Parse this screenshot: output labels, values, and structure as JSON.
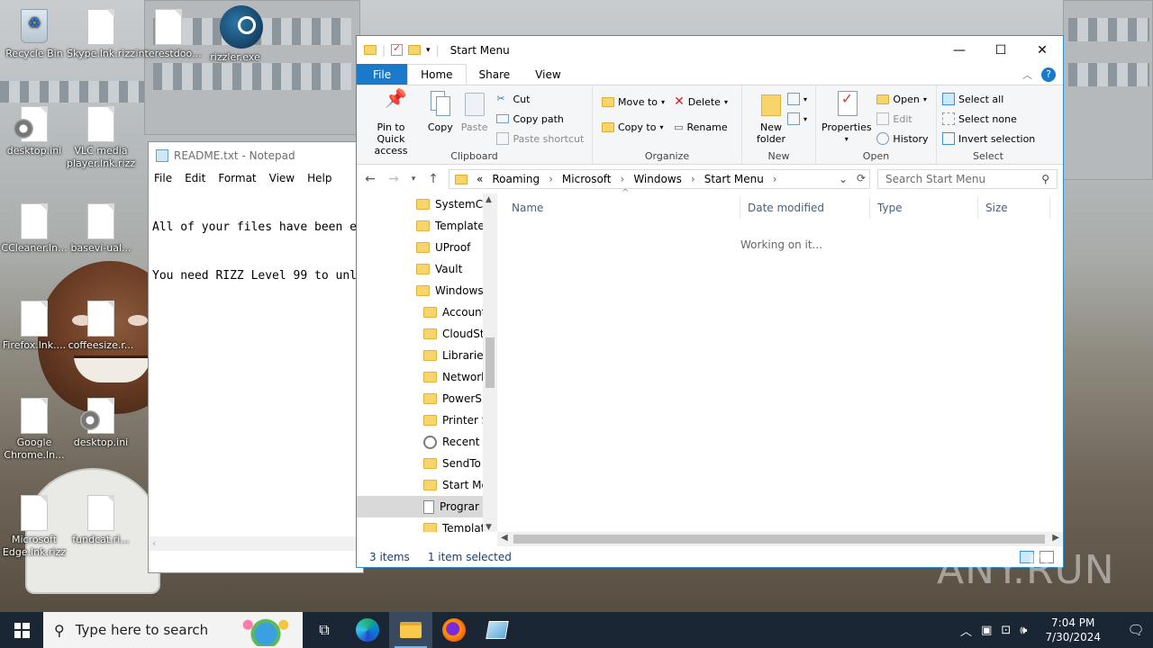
{
  "desktop": {
    "icons": [
      {
        "label": "Recycle Bin"
      },
      {
        "label": "Skype.lnk.rizz"
      },
      {
        "label": "interestdoo..."
      },
      {
        "label": "rizzler.exe"
      },
      {
        "label": "desktop.ini"
      },
      {
        "label": "VLC media player.lnk.rizz"
      },
      {
        "label": "CCleaner.ln..."
      },
      {
        "label": "basevi-ual..."
      },
      {
        "label": "Firefox.lnk...."
      },
      {
        "label": "coffeesize.r..."
      },
      {
        "label": "Google Chrome.ln..."
      },
      {
        "label": "desktop.ini"
      },
      {
        "label": "Microsoft Edge.lnk.rizz"
      },
      {
        "label": "fundcat.ri..."
      }
    ]
  },
  "notepad": {
    "title": "README.txt - Notepad",
    "menu": [
      "File",
      "Edit",
      "Format",
      "View",
      "Help"
    ],
    "lines": [
      "All of your files have been e",
      "You need RIZZ Level 99 to unl"
    ]
  },
  "explorer": {
    "title": "Start Menu",
    "tabs": {
      "file": "File",
      "home": "Home",
      "share": "Share",
      "view": "View"
    },
    "ribbon": {
      "clipboard": {
        "label": "Clipboard",
        "pin": "Pin to Quick access",
        "copy": "Copy",
        "paste": "Paste",
        "cut": "Cut",
        "copy_path": "Copy path",
        "paste_shortcut": "Paste shortcut"
      },
      "organize": {
        "label": "Organize",
        "move_to": "Move to",
        "copy_to": "Copy to",
        "delete": "Delete",
        "rename": "Rename"
      },
      "new": {
        "label": "New",
        "new_folder": "New folder"
      },
      "open": {
        "label": "Open",
        "properties": "Properties",
        "open": "Open",
        "edit": "Edit",
        "history": "History"
      },
      "select": {
        "label": "Select",
        "select_all": "Select all",
        "select_none": "Select none",
        "invert": "Invert selection"
      }
    },
    "address": {
      "overflow": "«",
      "crumbs": [
        "Roaming",
        "Microsoft",
        "Windows",
        "Start Menu"
      ]
    },
    "search_placeholder": "Search Start Menu",
    "nav_items": [
      {
        "label": "SystemCer",
        "icon": "folder",
        "sub": false
      },
      {
        "label": "Templates",
        "icon": "folder",
        "sub": false
      },
      {
        "label": "UProof",
        "icon": "folder",
        "sub": false
      },
      {
        "label": "Vault",
        "icon": "folder",
        "sub": false
      },
      {
        "label": "Windows",
        "icon": "folder",
        "sub": false
      },
      {
        "label": "Account",
        "icon": "folder",
        "sub": true
      },
      {
        "label": "CloudSto",
        "icon": "folder",
        "sub": true
      },
      {
        "label": "Libraries",
        "icon": "folder",
        "sub": true
      },
      {
        "label": "Network",
        "icon": "folder",
        "sub": true
      },
      {
        "label": "PowerSh",
        "icon": "folder",
        "sub": true
      },
      {
        "label": "Printer Sl",
        "icon": "folder",
        "sub": true
      },
      {
        "label": "Recent It",
        "icon": "recent",
        "sub": true
      },
      {
        "label": "SendTo",
        "icon": "folder",
        "sub": true
      },
      {
        "label": "Start Mer",
        "icon": "folder",
        "sub": true
      },
      {
        "label": "Prograr",
        "icon": "file",
        "sub": true,
        "selected": true
      },
      {
        "label": "Template",
        "icon": "folder",
        "sub": true
      }
    ],
    "columns": [
      "Name",
      "Date modified",
      "Type",
      "Size"
    ],
    "working_text": "Working on it...",
    "status": {
      "items": "3 items",
      "selected": "1 item selected"
    }
  },
  "taskbar": {
    "search_placeholder": "Type here to search",
    "time": "7:04 PM",
    "date": "7/30/2024"
  },
  "watermark": "ANY.RUN",
  "colors": {
    "accent": "#1979ca",
    "taskbar": "#1b2635",
    "folder": "#f8d46a"
  }
}
